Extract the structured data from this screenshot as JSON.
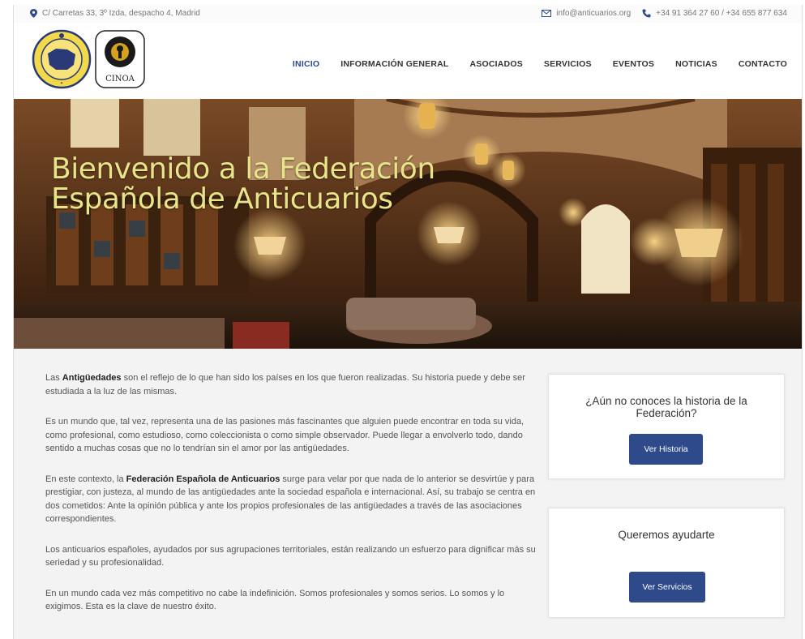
{
  "topbar": {
    "address": "C/ Carretas 33, 3º Izda, despacho 4, Madrid",
    "email": "info@anticuarios.org",
    "phone": "+34 91 364 27 60 / +34 655 877 634"
  },
  "logos": {
    "cinoa": "CINOA"
  },
  "nav": {
    "items": [
      "INICIO",
      "INFORMACIÓN GENERAL",
      "ASOCIADOS",
      "SERVICIOS",
      "EVENTOS",
      "NOTICIAS",
      "CONTACTO"
    ],
    "active": "INICIO"
  },
  "hero": {
    "title": "Bienvenido a la Federación Española de Anticuarios"
  },
  "content": {
    "p1_pre": "Las ",
    "p1_bold": "Antigüedades",
    "p1_post": " son el reflejo de lo que han sido los países en los que fueron realizadas. Su historia puede y debe ser estudiada a la luz de las mismas.",
    "p2": "Es un mundo que, tal vez, representa una de las pasiones más fascinantes que alguien puede encontrar en toda su vida, como profesional, como estudioso, como coleccionista o como simple observador. Puede llegar a envolverlo todo, dando sentido a muchas cosas que no lo tendrían sin el amor por las antigüedades.",
    "p3_pre": "En este contexto, la ",
    "p3_bold": "Federación Española de Anticuarios",
    "p3_post": " surge para velar por que nada de lo anterior se desvirtúe y para prestigiar, con justeza, al mundo de las antigüedades ante la sociedad española e internacional. Así, su trabajo se centra en dos cometidos: Ante la opinión pública y ante los propios profesionales de las antigüedades a través de las asociaciones correspondientes.",
    "p4": "Los anticuarios españoles, ayudados por sus agrupaciones territoriales, están realizando un esfuerzo para dignificar más su seriedad y su profesionalidad.",
    "p5": "En un mundo cada vez más competitivo no cabe la indefinición. Somos profesionales y somos serios. Lo somos y lo exigimos. Esta es la clave de nuestro éxito."
  },
  "cards": [
    {
      "title": "¿Aún no conoces la historia de la Federación?",
      "button": "Ver Historia"
    },
    {
      "title": "Queremos ayudarte",
      "button": "Ver Servicios"
    }
  ],
  "colors": {
    "accent": "#2f4a8a",
    "hero_title": "#e8e48a"
  }
}
